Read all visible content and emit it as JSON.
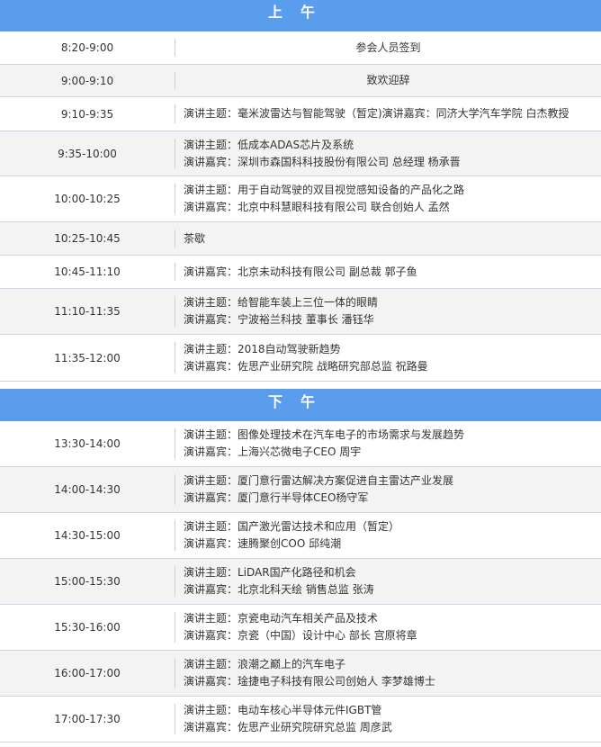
{
  "morning": {
    "header": "上午",
    "rows": [
      {
        "time": "8:20-9:00",
        "lines": [
          "参会人员签到"
        ],
        "center": true
      },
      {
        "time": "9:00-9:10",
        "lines": [
          "致欢迎辞"
        ],
        "center": true
      },
      {
        "time": "9:10-9:35",
        "lines": [
          "演讲主题：毫米波雷达与智能驾驶（暂定)演讲嘉宾：同济大学汽车学院 白杰教授"
        ]
      },
      {
        "time": "9:35-10:00",
        "lines": [
          "演讲主题：低成本ADAS芯片及系统",
          "演讲嘉宾：深圳市森国科科技股份有限公司 总经理 杨承晋"
        ]
      },
      {
        "time": "10:00-10:25",
        "lines": [
          "演讲主题：用于自动驾驶的双目视觉感知设备的产品化之路",
          "演讲嘉宾：北京中科慧眼科技有限公司 联合创始人 孟然"
        ]
      },
      {
        "time": "10:25-10:45",
        "lines": [
          "茶歇"
        ]
      },
      {
        "time": "10:45-11:10",
        "lines": [
          "演讲嘉宾：北京未动科技有限公司 副总裁 郭子鱼"
        ]
      },
      {
        "time": "11:10-11:35",
        "lines": [
          "演讲主题：给智能车装上三位一体的眼睛",
          "演讲嘉宾：宁波裕兰科技 董事长 潘钰华"
        ]
      },
      {
        "time": "11:35-12:00",
        "lines": [
          "演讲主题：2018自动驾驶新趋势",
          "演讲嘉宾：佐思产业研究院 战略研究部总监 祝路曼"
        ]
      }
    ]
  },
  "afternoon": {
    "header": "下午",
    "rows": [
      {
        "time": "13:30-14:00",
        "lines": [
          "演讲主题：图像处理技术在汽车电子的市场需求与发展趋势",
          "演讲嘉宾：上海兴芯微电子CEO 周宇"
        ]
      },
      {
        "time": "14:00-14:30",
        "lines": [
          "演讲主题：厦门意行雷达解决方案促进自主雷达产业发展",
          "演讲嘉宾：厦门意行半导体CEO杨守军"
        ]
      },
      {
        "time": "14:30-15:00",
        "lines": [
          "演讲主题：国产激光雷达技术和应用（暂定）",
          "演讲嘉宾：速腾聚创COO 邱纯潮"
        ]
      },
      {
        "time": "15:00-15:30",
        "lines": [
          "演讲主题：LiDAR国产化路径和机会",
          "演讲嘉宾：北京北科天绘 销售总监 张涛"
        ]
      },
      {
        "time": "15:30-16:00",
        "lines": [
          "演讲主题：京瓷电动汽车相关产品及技术",
          "演讲嘉宾：京瓷（中国）设计中心 部长 宫原将章"
        ]
      },
      {
        "time": "16:00-17:00",
        "lines": [
          "演讲主题：浪潮之巅上的汽车电子",
          "演讲嘉宾：琻捷电子科技有限公司创始人 李梦雄博士"
        ]
      },
      {
        "time": "17:00-17:30",
        "lines": [
          "演讲主题：电动车核心半导体元件IGBT管",
          "演讲嘉宾：佐思产业研究院研究总监 周彦武"
        ]
      }
    ]
  }
}
